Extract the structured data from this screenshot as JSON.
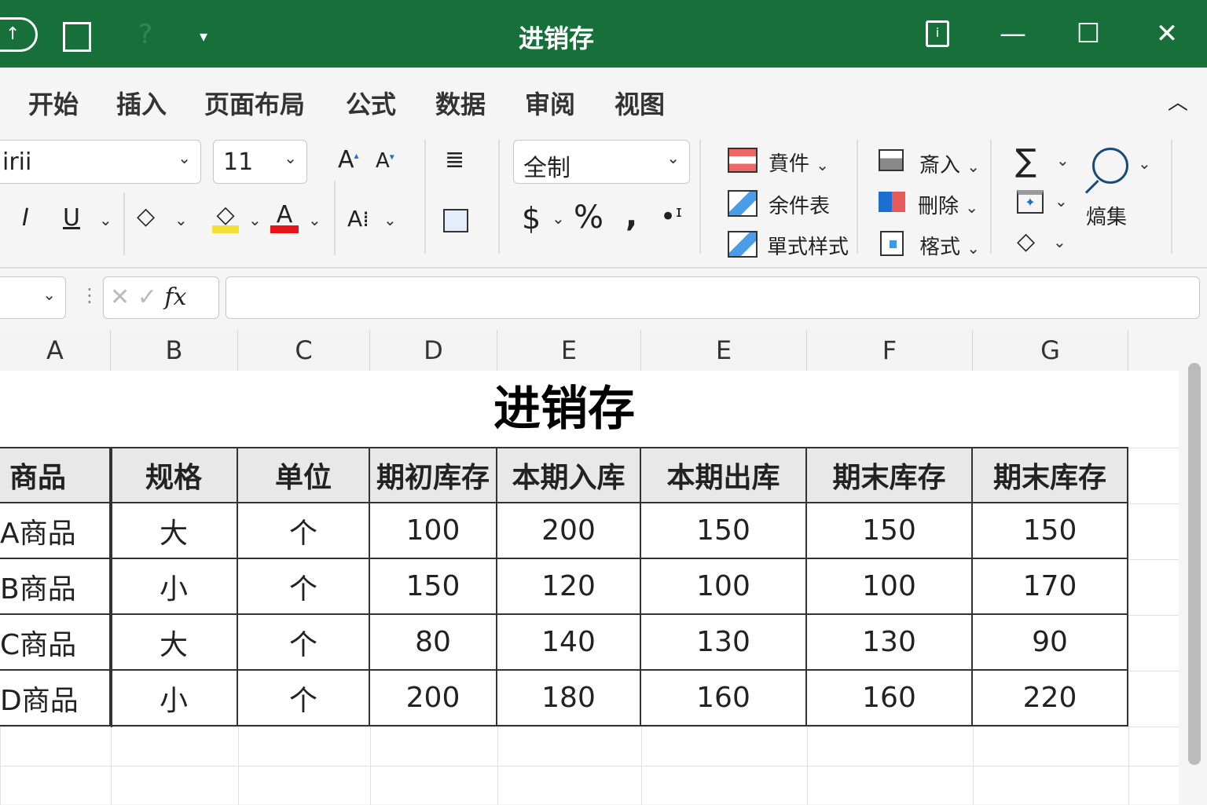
{
  "window": {
    "title": "进销存",
    "icons": [
      "autosave-icon",
      "save-icon",
      "undo-icon",
      "customize-icon",
      "ribbon-display-icon",
      "minimize-icon",
      "maximize-icon",
      "close-icon"
    ]
  },
  "tabs": [
    "开始",
    "插入",
    "页面布局",
    "公式",
    "数据",
    "审阅",
    "视图"
  ],
  "font": {
    "name": "irii",
    "size": "11"
  },
  "number_format": "全制",
  "styles": {
    "conditional": "賁件",
    "table": "余件表",
    "cell_styles": "單式样式"
  },
  "cells_group": {
    "insert": "斎入",
    "delete": "刪除",
    "format": "楁式"
  },
  "editing": {
    "find": "熇集"
  },
  "formula_bar": {
    "fx": "fx",
    "value": ""
  },
  "columns": [
    "A",
    "B",
    "C",
    "D",
    "E",
    "E",
    "F",
    "G"
  ],
  "sheet": {
    "title": "进销存",
    "headers": [
      "商品",
      "规格",
      "单位",
      "期初库存",
      "本期入库",
      "本期出库",
      "期末库存",
      "期末库存"
    ],
    "rows": [
      [
        "A商品",
        "大",
        "个",
        "100",
        "200",
        "150",
        "150",
        "150"
      ],
      [
        "B商品",
        "小",
        "个",
        "150",
        "120",
        "100",
        "100",
        "170"
      ],
      [
        "C商品",
        "大",
        "个",
        "80",
        "140",
        "130",
        "130",
        "90"
      ],
      [
        "D商品",
        "小",
        "个",
        "200",
        "180",
        "160",
        "160",
        "220"
      ]
    ]
  },
  "colors": {
    "brand": "#17703a",
    "highlight": "#f5e03a",
    "font_color": "#e8141b"
  }
}
